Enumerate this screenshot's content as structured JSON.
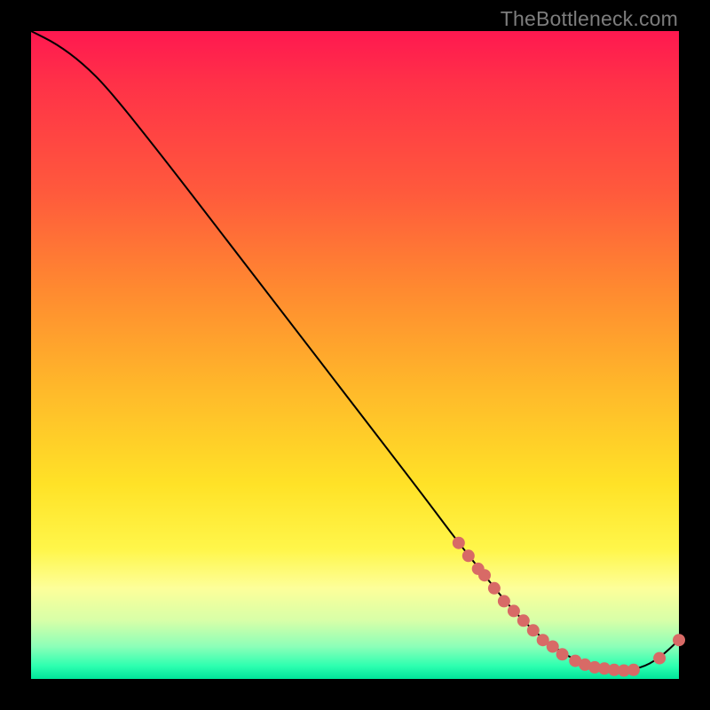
{
  "watermark": "TheBottleneck.com",
  "chart_data": {
    "type": "line",
    "title": "",
    "xlabel": "",
    "ylabel": "",
    "xlim": [
      0,
      100
    ],
    "ylim": [
      0,
      100
    ],
    "curve": {
      "x": [
        0,
        4,
        8,
        12,
        20,
        30,
        40,
        50,
        60,
        66,
        70,
        74,
        78,
        82,
        85,
        88,
        91,
        94,
        97,
        100
      ],
      "y": [
        100,
        98,
        95,
        91,
        81,
        68,
        55,
        42,
        29,
        21,
        16,
        11,
        7,
        4,
        2.5,
        1.8,
        1.4,
        1.6,
        3.2,
        6
      ]
    },
    "markers": [
      {
        "x": 66.0,
        "y": 21.0
      },
      {
        "x": 67.5,
        "y": 19.0
      },
      {
        "x": 69.0,
        "y": 17.0
      },
      {
        "x": 70.0,
        "y": 16.0
      },
      {
        "x": 71.5,
        "y": 14.0
      },
      {
        "x": 73.0,
        "y": 12.0
      },
      {
        "x": 74.5,
        "y": 10.5
      },
      {
        "x": 76.0,
        "y": 9.0
      },
      {
        "x": 77.5,
        "y": 7.5
      },
      {
        "x": 79.0,
        "y": 6.0
      },
      {
        "x": 80.5,
        "y": 5.0
      },
      {
        "x": 82.0,
        "y": 3.8
      },
      {
        "x": 84.0,
        "y": 2.8
      },
      {
        "x": 85.5,
        "y": 2.2
      },
      {
        "x": 87.0,
        "y": 1.8
      },
      {
        "x": 88.5,
        "y": 1.6
      },
      {
        "x": 90.0,
        "y": 1.4
      },
      {
        "x": 91.5,
        "y": 1.3
      },
      {
        "x": 93.0,
        "y": 1.4
      },
      {
        "x": 97.0,
        "y": 3.2
      },
      {
        "x": 100.0,
        "y": 6.0
      }
    ],
    "colors": {
      "line": "#000000",
      "marker": "#d86a66"
    },
    "gradient_stops": [
      {
        "pos": 0.0,
        "color": "#ff1850"
      },
      {
        "pos": 0.4,
        "color": "#ff8a30"
      },
      {
        "pos": 0.7,
        "color": "#ffe227"
      },
      {
        "pos": 0.9,
        "color": "#d7ffa8"
      },
      {
        "pos": 1.0,
        "color": "#00e59a"
      }
    ]
  }
}
